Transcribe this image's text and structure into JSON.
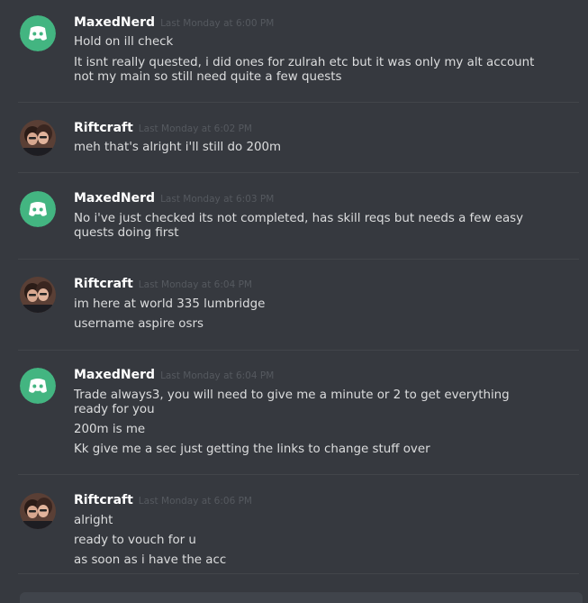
{
  "messages": [
    {
      "author": "MaxedNerd",
      "timestamp": "Last Monday at 6:00 PM",
      "avatar": "discord-default-avatar",
      "lines": [
        "Hold on ill check",
        "It isnt really quested, i did ones for zulrah etc but it was only my alt account not my main so still need quite a few quests"
      ]
    },
    {
      "author": "Riftcraft",
      "timestamp": "Last Monday at 6:02 PM",
      "avatar": "photo-avatar",
      "lines": [
        "meh that's alright i'll still do 200m"
      ]
    },
    {
      "author": "MaxedNerd",
      "timestamp": "Last Monday at 6:03 PM",
      "avatar": "discord-default-avatar",
      "lines": [
        "No i've just checked its not completed, has skill reqs but needs a few easy quests doing first"
      ]
    },
    {
      "author": "Riftcraft",
      "timestamp": "Last Monday at 6:04 PM",
      "avatar": "photo-avatar",
      "lines": [
        "im here at world 335 lumbridge",
        "username aspire osrs"
      ]
    },
    {
      "author": "MaxedNerd",
      "timestamp": "Last Monday at 6:04 PM",
      "avatar": "discord-default-avatar",
      "lines": [
        "Trade always3, you will need to give me a minute or 2 to get everything ready for you",
        "200m is me",
        "Kk give me a sec just getting the links to change stuff over"
      ]
    },
    {
      "author": "Riftcraft",
      "timestamp": "Last Monday at 6:06 PM",
      "avatar": "photo-avatar",
      "lines": [
        "alright",
        "ready to vouch for u",
        "as soon as i have the acc"
      ]
    }
  ],
  "colors": {
    "background": "#36393f",
    "discord_avatar": "#43b581",
    "author": "#ffffff",
    "text": "#dcddde",
    "timestamp": "#55595f"
  }
}
